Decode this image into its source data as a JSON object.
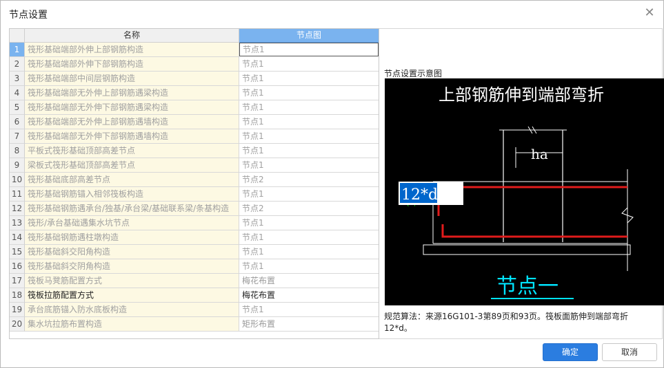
{
  "dialog": {
    "title": "节点设置",
    "close_icon": "close-icon"
  },
  "table": {
    "headers": {
      "name": "名称",
      "node": "节点图"
    },
    "rows": [
      {
        "idx": "1",
        "name": "筏形基础端部外伸上部钢筋构造",
        "node": "节点1"
      },
      {
        "idx": "2",
        "name": "筏形基础端部外伸下部钢筋构造",
        "node": "节点1"
      },
      {
        "idx": "3",
        "name": "筏形基础端部中间层钢筋构造",
        "node": "节点1"
      },
      {
        "idx": "4",
        "name": "筏形基础端部无外伸上部钢筋遇梁构造",
        "node": "节点1"
      },
      {
        "idx": "5",
        "name": "筏形基础端部无外伸下部钢筋遇梁构造",
        "node": "节点1"
      },
      {
        "idx": "6",
        "name": "筏形基础端部无外伸上部钢筋遇墙构造",
        "node": "节点1"
      },
      {
        "idx": "7",
        "name": "筏形基础端部无外伸下部钢筋遇墙构造",
        "node": "节点1"
      },
      {
        "idx": "8",
        "name": "平板式筏形基础顶部高差节点",
        "node": "节点1"
      },
      {
        "idx": "9",
        "name": "梁板式筏形基础顶部高差节点",
        "node": "节点1"
      },
      {
        "idx": "10",
        "name": "筏形基础底部高差节点",
        "node": "节点2"
      },
      {
        "idx": "11",
        "name": "筏形基础钢筋锚入相邻筏板构造",
        "node": "节点1"
      },
      {
        "idx": "12",
        "name": "筏形基础钢筋遇承台/独基/承台梁/基础联系梁/条基构造",
        "node": "节点2"
      },
      {
        "idx": "13",
        "name": "筏形/承台基础遇集水坑节点",
        "node": "节点1"
      },
      {
        "idx": "14",
        "name": "筏形基础钢筋遇柱墩构造",
        "node": "节点1"
      },
      {
        "idx": "15",
        "name": "筏形基础斜交阳角构造",
        "node": "节点1"
      },
      {
        "idx": "16",
        "name": "筏形基础斜交阴角构造",
        "node": "节点1"
      },
      {
        "idx": "17",
        "name": "筏板马凳筋配置方式",
        "node": "梅花布置"
      },
      {
        "idx": "18",
        "name": "筏板拉筋配置方式",
        "node": "梅花布置"
      },
      {
        "idx": "19",
        "name": "承台底筋锚入防水底板构造",
        "node": "节点1"
      },
      {
        "idx": "20",
        "name": "集水坑拉筋布置构造",
        "node": "矩形布置"
      }
    ]
  },
  "preview": {
    "label": "节点设置示意图",
    "diagram": {
      "heading": "上部钢筋伸到端部弯折",
      "dim_ha": "ha",
      "dim_12d": "12*d",
      "dim_12d_vertical": "12d",
      "node_name": "节点一"
    },
    "description": "规范算法：来源16G101-3第89页和93页。筏板面筋伸到端部弯折12*d。"
  },
  "buttons": {
    "ok": "确定",
    "cancel": "取消"
  },
  "colors": {
    "accent": "#2b7de0",
    "header_selected": "#7ab3ef",
    "rebar": "#e01b1b",
    "node_title": "#00e5ff",
    "dim_green": "#00d000"
  }
}
